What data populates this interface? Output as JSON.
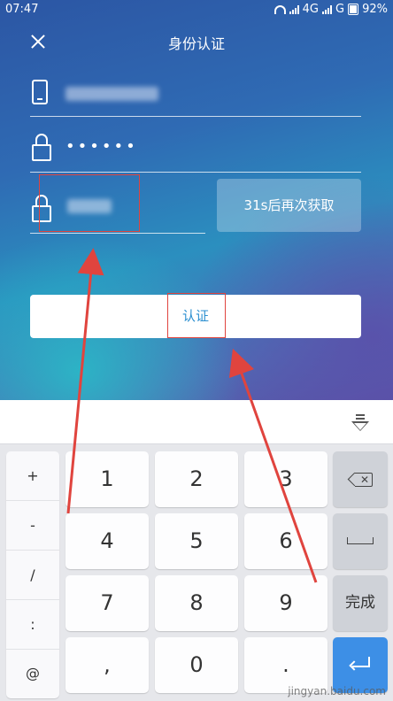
{
  "status_bar": {
    "time": "07:47",
    "network_1": "4G",
    "network_2": "G",
    "battery": "92%"
  },
  "header": {
    "title": "身份认证"
  },
  "form": {
    "phone_value_visible": "",
    "password_value": "••••••",
    "code_value_visible": "",
    "resend_label": "31s后再次获取",
    "submit_label": "认证"
  },
  "keyboard": {
    "symbols": [
      "+",
      "-",
      "/",
      ":",
      "@"
    ],
    "digits": [
      "1",
      "2",
      "3",
      "4",
      "5",
      "6",
      "7",
      "8",
      "9",
      ",",
      "0",
      "."
    ],
    "done_label": "完成"
  },
  "watermark": "jingyan.baidu.com",
  "colors": {
    "accent": "#2c8fd0",
    "annotation": "#e0443e",
    "enter_key": "#3d8fe6"
  }
}
